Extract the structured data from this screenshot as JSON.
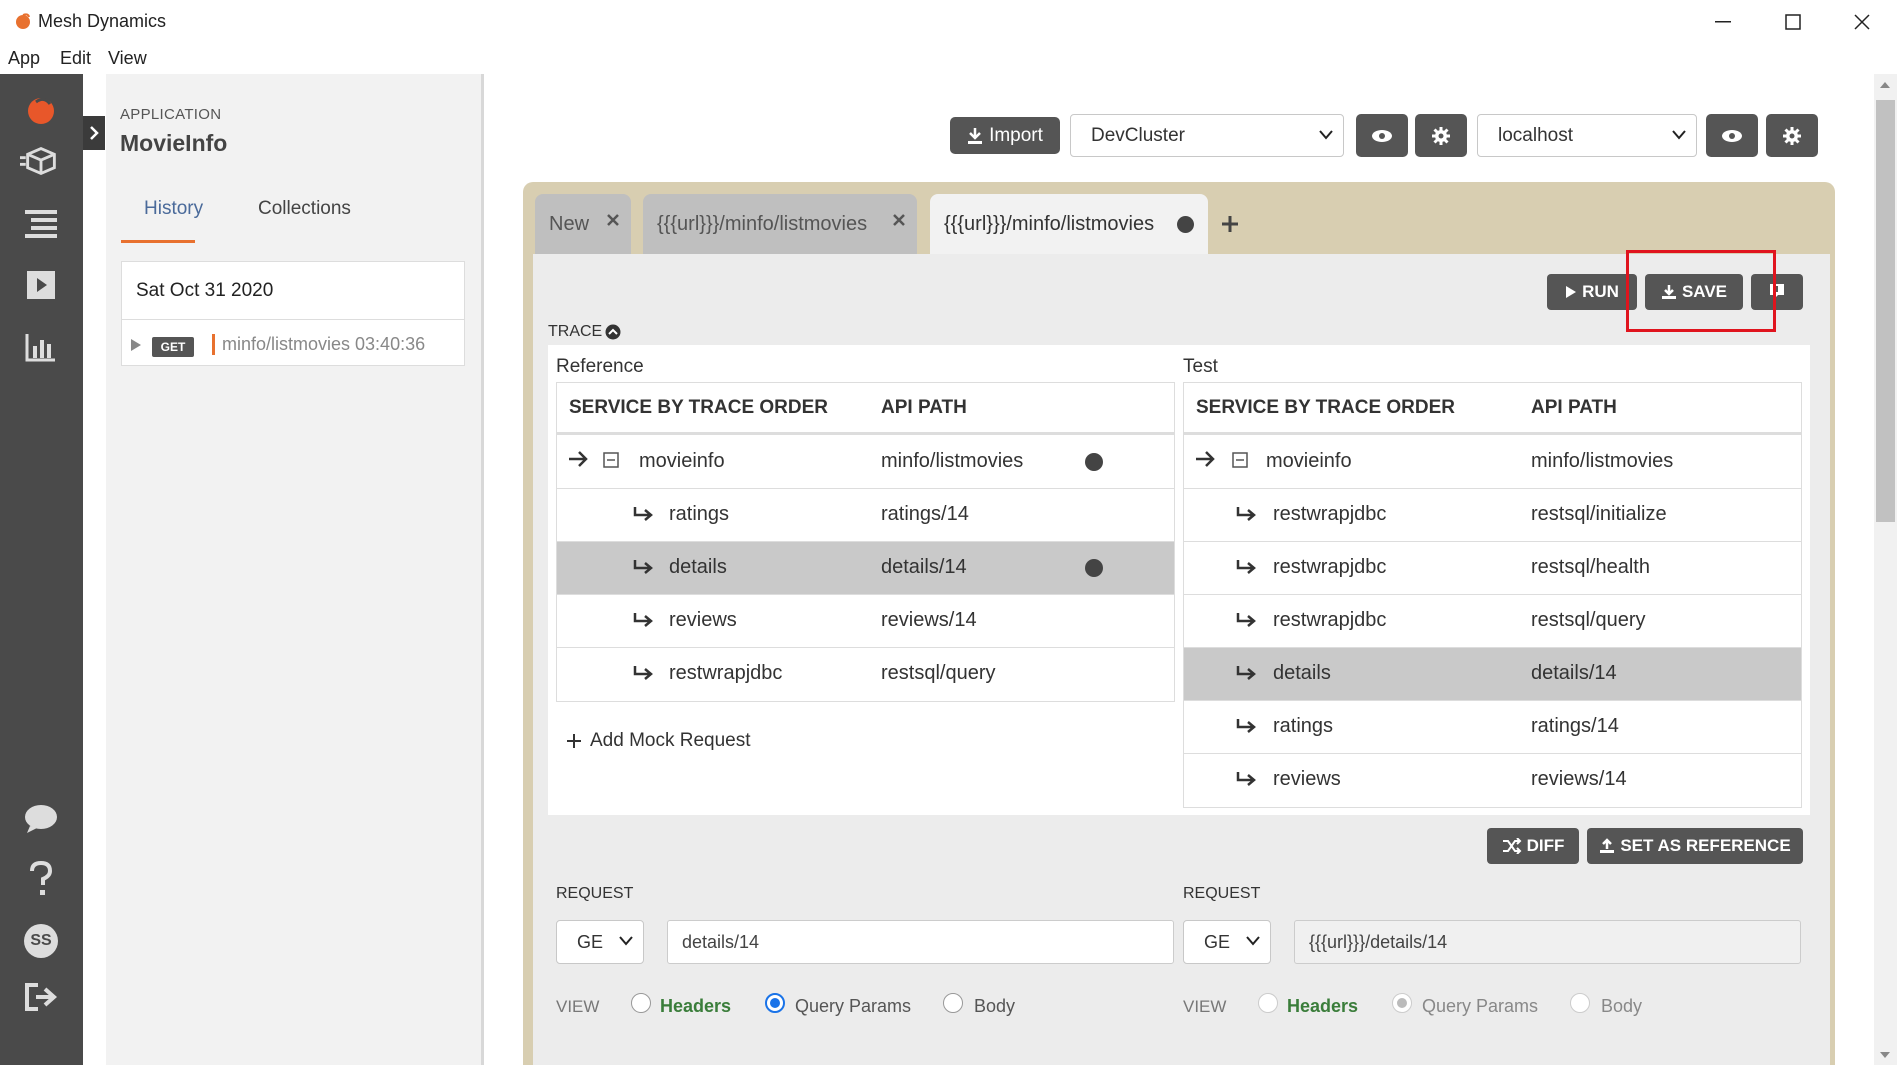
{
  "window": {
    "title": "Mesh Dynamics"
  },
  "menu": [
    "App",
    "Edit",
    "View"
  ],
  "app": {
    "label": "APPLICATION",
    "name": "MovieInfo",
    "tabs": [
      "History",
      "Collections"
    ],
    "history": {
      "date": "Sat Oct 31 2020",
      "items": [
        {
          "method": "GET",
          "path": "minfo/listmovies 03:40:36"
        }
      ]
    }
  },
  "toolbar": {
    "import_label": "Import",
    "cluster": "DevCluster",
    "host": "localhost"
  },
  "tabs": [
    {
      "label": "New"
    },
    {
      "label": "{{{url}}}/minfo/listmovies"
    },
    {
      "label": "{{{url}}}/minfo/listmovies"
    }
  ],
  "actions": {
    "run": "RUN",
    "save": "SAVE",
    "diff": "DIFF",
    "set_ref": "SET AS REFERENCE"
  },
  "trace_label": "TRACE",
  "reference": {
    "title": "Reference",
    "headers": [
      "SERVICE BY TRACE ORDER",
      "API PATH"
    ],
    "rows": [
      {
        "service": "movieinfo",
        "path": "minfo/listmovies"
      },
      {
        "service": "ratings",
        "path": "ratings/14"
      },
      {
        "service": "details",
        "path": "details/14"
      },
      {
        "service": "reviews",
        "path": "reviews/14"
      },
      {
        "service": "restwrapjdbc",
        "path": "restsql/query"
      }
    ],
    "add_mock": "Add Mock Request"
  },
  "test": {
    "title": "Test",
    "headers": [
      "SERVICE BY TRACE ORDER",
      "API PATH"
    ],
    "rows": [
      {
        "service": "movieinfo",
        "path": "minfo/listmovies"
      },
      {
        "service": "restwrapjdbc",
        "path": "restsql/initialize"
      },
      {
        "service": "restwrapjdbc",
        "path": "restsql/health"
      },
      {
        "service": "restwrapjdbc",
        "path": "restsql/query"
      },
      {
        "service": "details",
        "path": "details/14"
      },
      {
        "service": "ratings",
        "path": "ratings/14"
      },
      {
        "service": "reviews",
        "path": "reviews/14"
      }
    ]
  },
  "request_left": {
    "label": "REQUEST",
    "method": "GE",
    "url": "details/14",
    "view": "VIEW",
    "options": [
      "Headers",
      "Query Params",
      "Body"
    ]
  },
  "request_right": {
    "label": "REQUEST",
    "method": "GE",
    "url": "{{{url}}}/details/14",
    "view": "VIEW",
    "options": [
      "Headers",
      "Query Params",
      "Body"
    ]
  },
  "user_initials": "SS",
  "colors": {
    "accent": "#e8712f",
    "rail": "#4a4a4a",
    "button": "#555555",
    "highlight": "#e0141e",
    "headers_link": "#3a7d3a"
  }
}
